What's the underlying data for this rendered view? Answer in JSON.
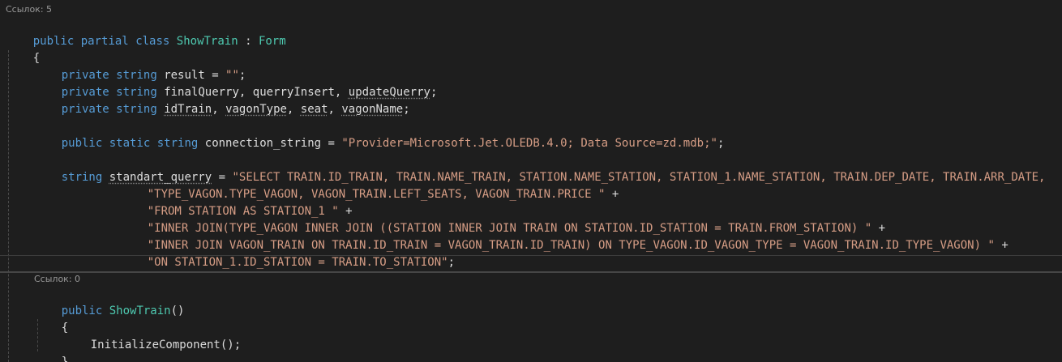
{
  "editor": {
    "codelens_class": "Ссылок: 5",
    "codelens_ctor": "Ссылок: 0",
    "lines": {
      "l1": {
        "kw1": "public",
        "kw2": "partial",
        "kw3": "class",
        "class_name": "ShowTrain",
        "colon": " : ",
        "base": "Form"
      },
      "l2": {
        "brace": "{"
      },
      "l3": {
        "kw1": "private",
        "kw2": "string",
        "rest": "result = ",
        "str": "\"\"",
        "end": ";"
      },
      "l4": {
        "kw1": "private",
        "kw2": "string",
        "a": "finalQuerry",
        "sep1": ", ",
        "b": "querryInsert",
        "sep2": ", ",
        "c": "updateQuerry",
        "end": ";"
      },
      "l5": {
        "kw1": "private",
        "kw2": "string",
        "a": "idTrain",
        "sep1": ", ",
        "b": "vagonType",
        "sep2": ", ",
        "c": "seat",
        "sep3": ", ",
        "d": "vagonName",
        "end": ";"
      },
      "l6": {
        "kw1": "public",
        "kw2": "static",
        "kw3": "string",
        "rest": "connection_string = ",
        "str": "\"Provider=Microsoft.Jet.OLEDB.4.0; Data Source=zd.mdb;\"",
        "end": ";"
      },
      "l7": {
        "kw1": "string",
        "name": "standart_querry",
        "eq": " = ",
        "str": "\"SELECT TRAIN.ID_TRAIN, TRAIN.NAME_TRAIN, STATION.NAME_STATION, STATION_1.NAME_STATION, TRAIN.DEP_DATE, TRAIN.ARR_DATE,"
      },
      "l8": {
        "str": "\"TYPE_VAGON.TYPE_VAGON, VAGON_TRAIN.LEFT_SEATS, VAGON_TRAIN.PRICE \"",
        "plus": " +"
      },
      "l9": {
        "str": "\"FROM STATION AS STATION_1 \"",
        "plus": " +"
      },
      "l10": {
        "str": "\"INNER JOIN(TYPE_VAGON INNER JOIN ((STATION INNER JOIN TRAIN ON STATION.ID_STATION = TRAIN.FROM_STATION) \"",
        "plus": " +"
      },
      "l11": {
        "str": "\"INNER JOIN VAGON_TRAIN ON TRAIN.ID_TRAIN = VAGON_TRAIN.ID_TRAIN) ON TYPE_VAGON.ID_VAGON_TYPE = VAGON_TRAIN.ID_TYPE_VAGON) \"",
        "plus": " +"
      },
      "l12": {
        "str": "\"ON STATION_1.ID_STATION = TRAIN.TO_STATION\"",
        "end": ";"
      },
      "l13": {
        "kw1": "public",
        "name": "ShowTrain",
        "parens": "()"
      },
      "l14": {
        "brace": "{"
      },
      "l15": {
        "call": "InitializeComponent();"
      },
      "l16": {
        "brace": "}"
      }
    },
    "colors": {
      "background": "#1e1e1e",
      "keyword": "#569cd6",
      "type": "#4ec9b0",
      "string": "#d69d85",
      "text": "#dcdcdc",
      "codelens": "#999999"
    }
  }
}
